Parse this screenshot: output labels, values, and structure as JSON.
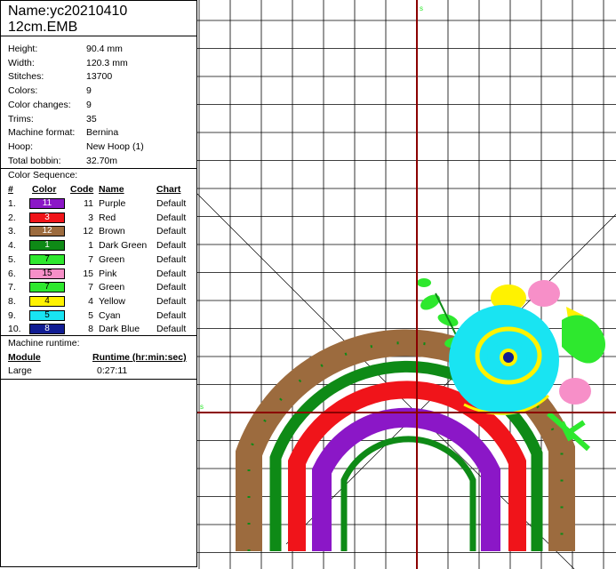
{
  "header": {
    "title_line1": "Name:yc20210410",
    "title_line2": "12cm.EMB"
  },
  "info": [
    {
      "label": "Height:",
      "value": "90.4 mm"
    },
    {
      "label": "Width:",
      "value": "120.3 mm"
    },
    {
      "label": "Stitches:",
      "value": "13700"
    },
    {
      "label": "Colors:",
      "value": "9"
    },
    {
      "label": "Color changes:",
      "value": "9"
    },
    {
      "label": "Trims:",
      "value": "35"
    },
    {
      "label": "Machine format:",
      "value": "Bernina"
    },
    {
      "label": "Hoop:",
      "value": "New Hoop (1)"
    },
    {
      "label": "Total bobbin:",
      "value": "32.70m"
    }
  ],
  "color_sequence": {
    "title": "Color Sequence:",
    "headers": {
      "num": "#",
      "color": "Color",
      "code": "Code",
      "name": "Name",
      "chart": "Chart"
    },
    "rows": [
      {
        "num": "1.",
        "code": "11",
        "name": "Purple",
        "chart": "Default",
        "hex": "#8B17C7",
        "text": "#ffffff"
      },
      {
        "num": "2.",
        "code": "3",
        "name": "Red",
        "chart": "Default",
        "hex": "#F0141A",
        "text": "#ffffff"
      },
      {
        "num": "3.",
        "code": "12",
        "name": "Brown",
        "chart": "Default",
        "hex": "#9C6B3E",
        "text": "#ffffff"
      },
      {
        "num": "4.",
        "code": "1",
        "name": "Dark Green",
        "chart": "Default",
        "hex": "#0E8A16",
        "text": "#ffffff"
      },
      {
        "num": "5.",
        "code": "7",
        "name": "Green",
        "chart": "Default",
        "hex": "#2EE82E",
        "text": "#000000"
      },
      {
        "num": "6.",
        "code": "15",
        "name": "Pink",
        "chart": "Default",
        "hex": "#F78FC8",
        "text": "#000000"
      },
      {
        "num": "7.",
        "code": "7",
        "name": "Green",
        "chart": "Default",
        "hex": "#2EE82E",
        "text": "#000000"
      },
      {
        "num": "8.",
        "code": "4",
        "name": "Yellow",
        "chart": "Default",
        "hex": "#FFF200",
        "text": "#000000"
      },
      {
        "num": "9.",
        "code": "5",
        "name": "Cyan",
        "chart": "Default",
        "hex": "#19E4F2",
        "text": "#000000"
      },
      {
        "num": "10.",
        "code": "8",
        "name": "Dark Blue",
        "chart": "Default",
        "hex": "#101C93",
        "text": "#ffffff"
      }
    ]
  },
  "runtime": {
    "title": "Machine runtime:",
    "headers": {
      "module": "Module",
      "runtime": "Runtime (hr:min:sec)"
    },
    "rows": [
      {
        "module": "Large",
        "time": "0:27:11"
      }
    ]
  },
  "canvas": {
    "start_marker": "s",
    "grid_color": "#000000",
    "axis_color": "#8B0000"
  }
}
